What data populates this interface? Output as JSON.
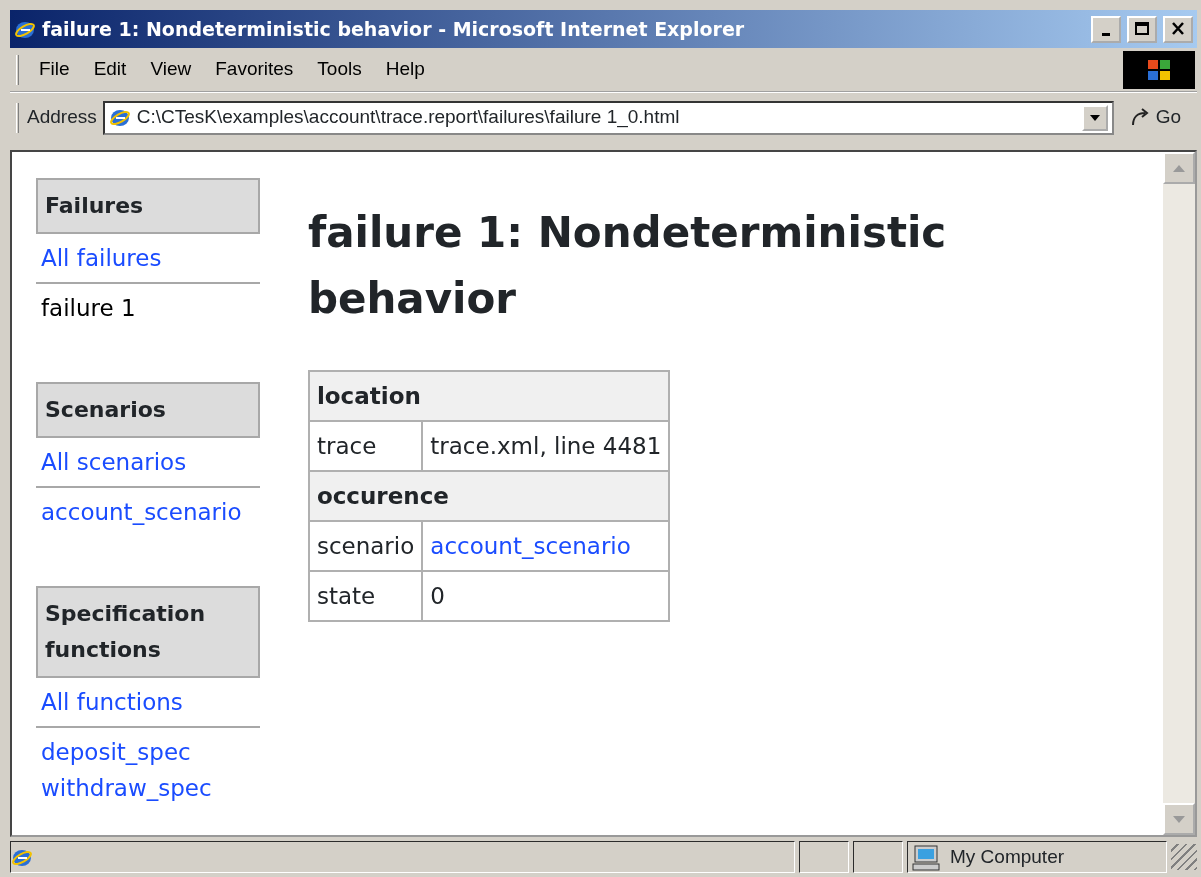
{
  "window": {
    "title": "failure 1: Nondeterministic behavior - Microsoft Internet Explorer"
  },
  "menu": [
    "File",
    "Edit",
    "View",
    "Favorites",
    "Tools",
    "Help"
  ],
  "address": {
    "label": "Address",
    "value": "C:\\CTesK\\examples\\account\\trace.report\\failures\\failure 1_0.html",
    "go": "Go"
  },
  "sidebar": [
    {
      "title": "Failures",
      "groups": [
        [
          {
            "label": "All failures",
            "kind": "link"
          }
        ],
        [
          {
            "label": "failure 1",
            "kind": "current"
          }
        ]
      ]
    },
    {
      "title": "Scenarios",
      "groups": [
        [
          {
            "label": "All scenarios",
            "kind": "link"
          }
        ],
        [
          {
            "label": "account_scenario",
            "kind": "link"
          }
        ]
      ]
    },
    {
      "title": "Specification functions",
      "groups": [
        [
          {
            "label": "All functions",
            "kind": "link"
          }
        ],
        [
          {
            "label": "deposit_spec",
            "kind": "link"
          },
          {
            "label": "withdraw_spec",
            "kind": "link"
          }
        ]
      ]
    }
  ],
  "heading": "failure 1: Nondeterministic behavior",
  "table": [
    {
      "kind": "section",
      "label": "location"
    },
    {
      "kind": "field",
      "label": "trace",
      "value": "trace.xml, line 4481"
    },
    {
      "kind": "section",
      "label": "occurence"
    },
    {
      "kind": "link_field",
      "label": "scenario",
      "value": "account_scenario"
    },
    {
      "kind": "field",
      "label": "state",
      "value": "0"
    }
  ],
  "status_bar": {
    "zone": "My Computer"
  }
}
